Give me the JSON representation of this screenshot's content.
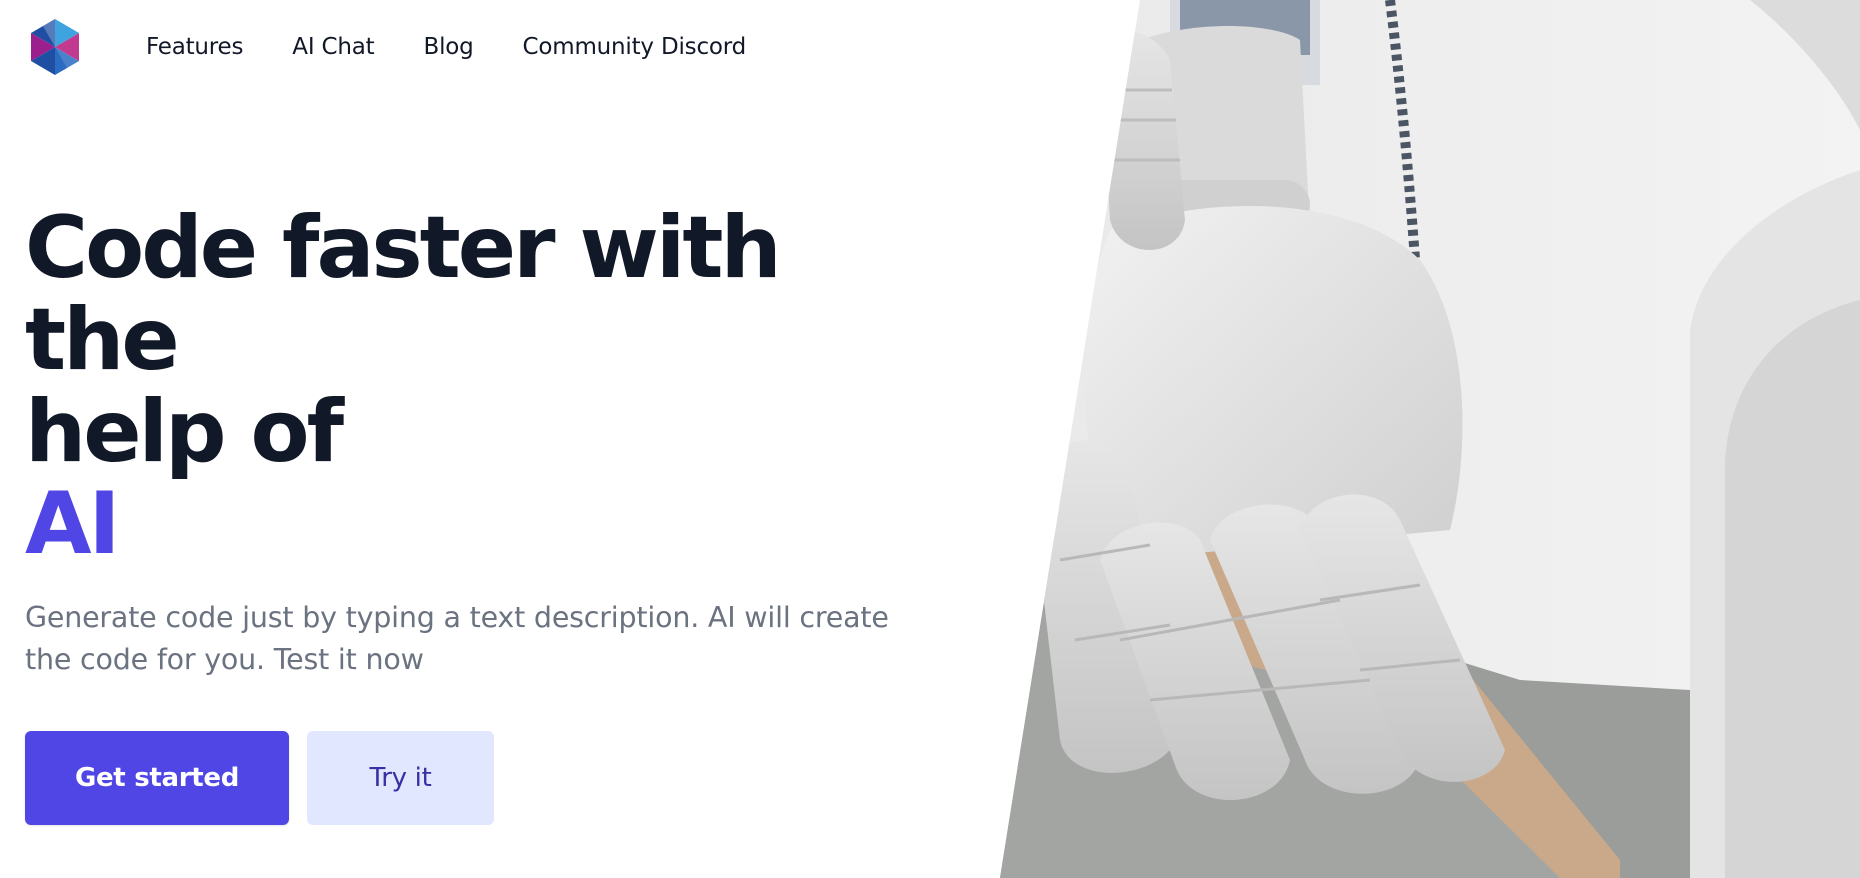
{
  "nav": {
    "logo_icon": "kaleidoscope-logo-icon",
    "links": [
      "Features",
      "AI Chat",
      "Blog",
      "Community Discord"
    ]
  },
  "hero": {
    "headline_line1": "Code faster with the",
    "headline_line2": "help of",
    "headline_accent": "AI",
    "subtitle": "Generate code just by typing a text description. AI will create the code for you. Test it now",
    "primary_button": "Get started",
    "secondary_button": "Try it"
  },
  "image": {
    "subject": "robot-hand-image"
  },
  "colors": {
    "accent": "#4f46e5",
    "accent_light": "#e0e7ff",
    "text_dark": "#111827",
    "text_muted": "#6b7280"
  }
}
